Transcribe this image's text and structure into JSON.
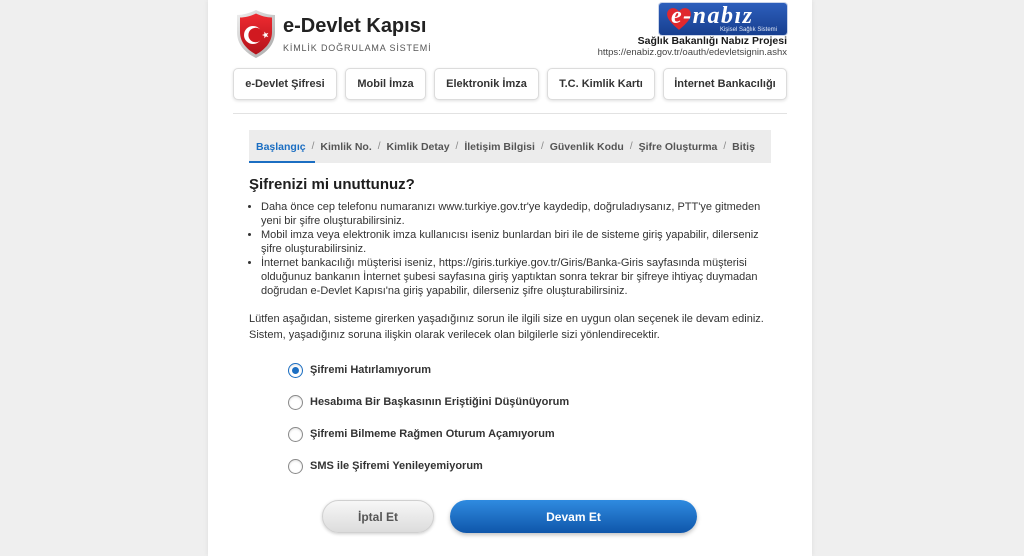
{
  "header": {
    "brand_logo_icon": "shield-crescent-star-icon",
    "brand_title": "e-Devlet Kapısı",
    "brand_subtitle": "KİMLİK DOĞRULAMA SİSTEMİ",
    "partner_logo": {
      "icon": "heart-icon",
      "text": "e-nabız",
      "tagline": "Kişisel Sağlık Sistemi"
    },
    "partner_name": "Sağlık Bakanlığı Nabız Projesi",
    "partner_url": "https://enabiz.gov.tr/oauth/edevletsignin.ashx"
  },
  "login_methods": [
    {
      "label": "e-Devlet Şifresi"
    },
    {
      "label": "Mobil İmza"
    },
    {
      "label": "Elektronik İmza"
    },
    {
      "label": "T.C. Kimlik Kartı"
    },
    {
      "label": "İnternet Bankacılığı"
    }
  ],
  "steps": {
    "separator": "/",
    "items": [
      {
        "label": "Başlangıç",
        "active": true
      },
      {
        "label": "Kimlik No.",
        "active": false
      },
      {
        "label": "Kimlik Detay",
        "active": false
      },
      {
        "label": "İletişim Bilgisi",
        "active": false
      },
      {
        "label": "Güvenlik Kodu",
        "active": false
      },
      {
        "label": "Şifre Oluşturma",
        "active": false
      },
      {
        "label": "Bitiş",
        "active": false
      }
    ]
  },
  "content": {
    "heading": "Şifrenizi mi unuttunuz?",
    "bullets": [
      "Daha önce cep telefonu numaranızı www.turkiye.gov.tr'ye kaydedip, doğruladıysanız, PTT'ye gitmeden yeni bir şifre oluşturabilirsiniz.",
      "Mobil imza veya elektronik imza kullanıcısı iseniz bunlardan biri ile de sisteme giriş yapabilir, dilerseniz şifre oluşturabilirsiniz.",
      "İnternet bankacılığı müşterisi iseniz, https://giris.turkiye.gov.tr/Giris/Banka-Giris sayfasında müşterisi olduğunuz bankanın İnternet şubesi sayfasına giriş yaptıktan sonra tekrar bir şifreye ihtiyaç duymadan doğrudan e-Devlet Kapısı'na giriş yapabilir, dilerseniz şifre oluşturabilirsiniz."
    ],
    "instruction": "Lütfen aşağıdan, sisteme girerken yaşadığınız sorun ile ilgili size en uygun olan seçenek ile devam ediniz. Sistem, yaşadığınız soruna ilişkin olarak verilecek olan bilgilerle sizi yönlendirecektir."
  },
  "options": [
    {
      "label": "Şifremi Hatırlamıyorum",
      "selected": true
    },
    {
      "label": "Hesabıma Bir Başkasının Eriştiğini Düşünüyorum",
      "selected": false
    },
    {
      "label": "Şifremi Bilmeme Rağmen Oturum Açamıyorum",
      "selected": false
    },
    {
      "label": "SMS ile Şifremi Yenileyemiyorum",
      "selected": false
    }
  ],
  "actions": {
    "cancel_label": "İptal Et",
    "continue_label": "Devam Et"
  },
  "colors": {
    "accent": "#1b6ec2",
    "brand_red": "#d71920",
    "partner_blue": "#173f8f",
    "page_bg": "#efefef"
  }
}
